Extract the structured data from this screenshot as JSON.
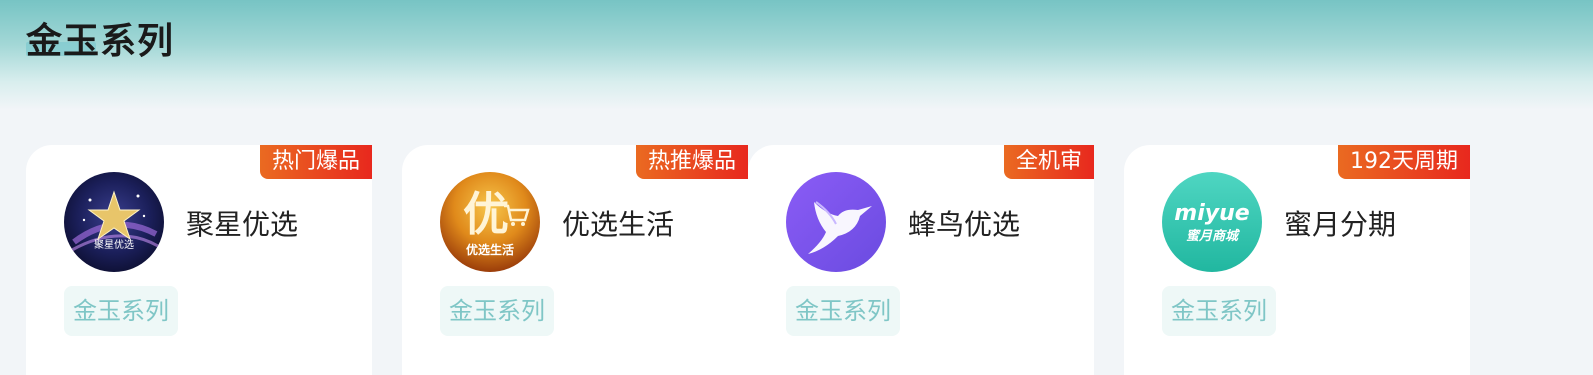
{
  "section": {
    "title": "金玉系列"
  },
  "cards": [
    {
      "badge": "热门爆品",
      "name": "聚星优选",
      "tag": "金玉系列",
      "logo_icon": "star-logo-icon",
      "logo_text": "聚星优选"
    },
    {
      "badge": "热推爆品",
      "name": "优选生活",
      "tag": "金玉系列",
      "logo_icon": "cart-logo-icon",
      "logo_char": "优",
      "logo_text": "优选生活"
    },
    {
      "badge": "全机审",
      "name": "蜂鸟优选",
      "tag": "金玉系列",
      "logo_icon": "hummingbird-logo-icon"
    },
    {
      "badge": "192天周期",
      "name": "蜜月分期",
      "tag": "金玉系列",
      "logo_icon": "miyue-logo-icon",
      "logo_line1": "miyue",
      "logo_line2": "蜜月商城"
    }
  ],
  "colors": {
    "header_gradient_top": "#77c4c4",
    "badge_start": "#ea6a21",
    "badge_end": "#e8281e",
    "tag_text": "#7fc6c6",
    "tag_bg": "#eef8f7"
  }
}
